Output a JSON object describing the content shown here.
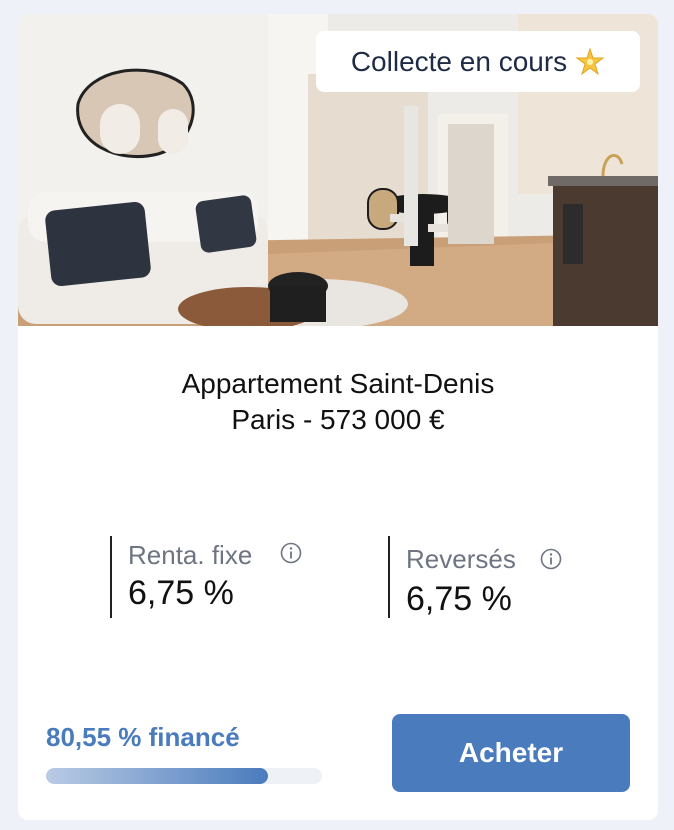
{
  "listing": {
    "status_badge": "Collecte en cours",
    "status_icon": "sparkle-star-icon",
    "title_line1": "Appartement Saint-Denis",
    "title_line2": "Paris - 573 000 €",
    "photo_alt": "apartment-interior-photo"
  },
  "stats": [
    {
      "label": "Renta. fixe",
      "value": "6,75 %"
    },
    {
      "label": "Reversés",
      "value": "6,75 %"
    }
  ],
  "funding": {
    "text": "80,55 % financé",
    "fraction": 0.8055
  },
  "actions": {
    "buy_label": "Acheter"
  },
  "colors": {
    "accent": "#4a7bbd",
    "background": "#eef2f8"
  }
}
